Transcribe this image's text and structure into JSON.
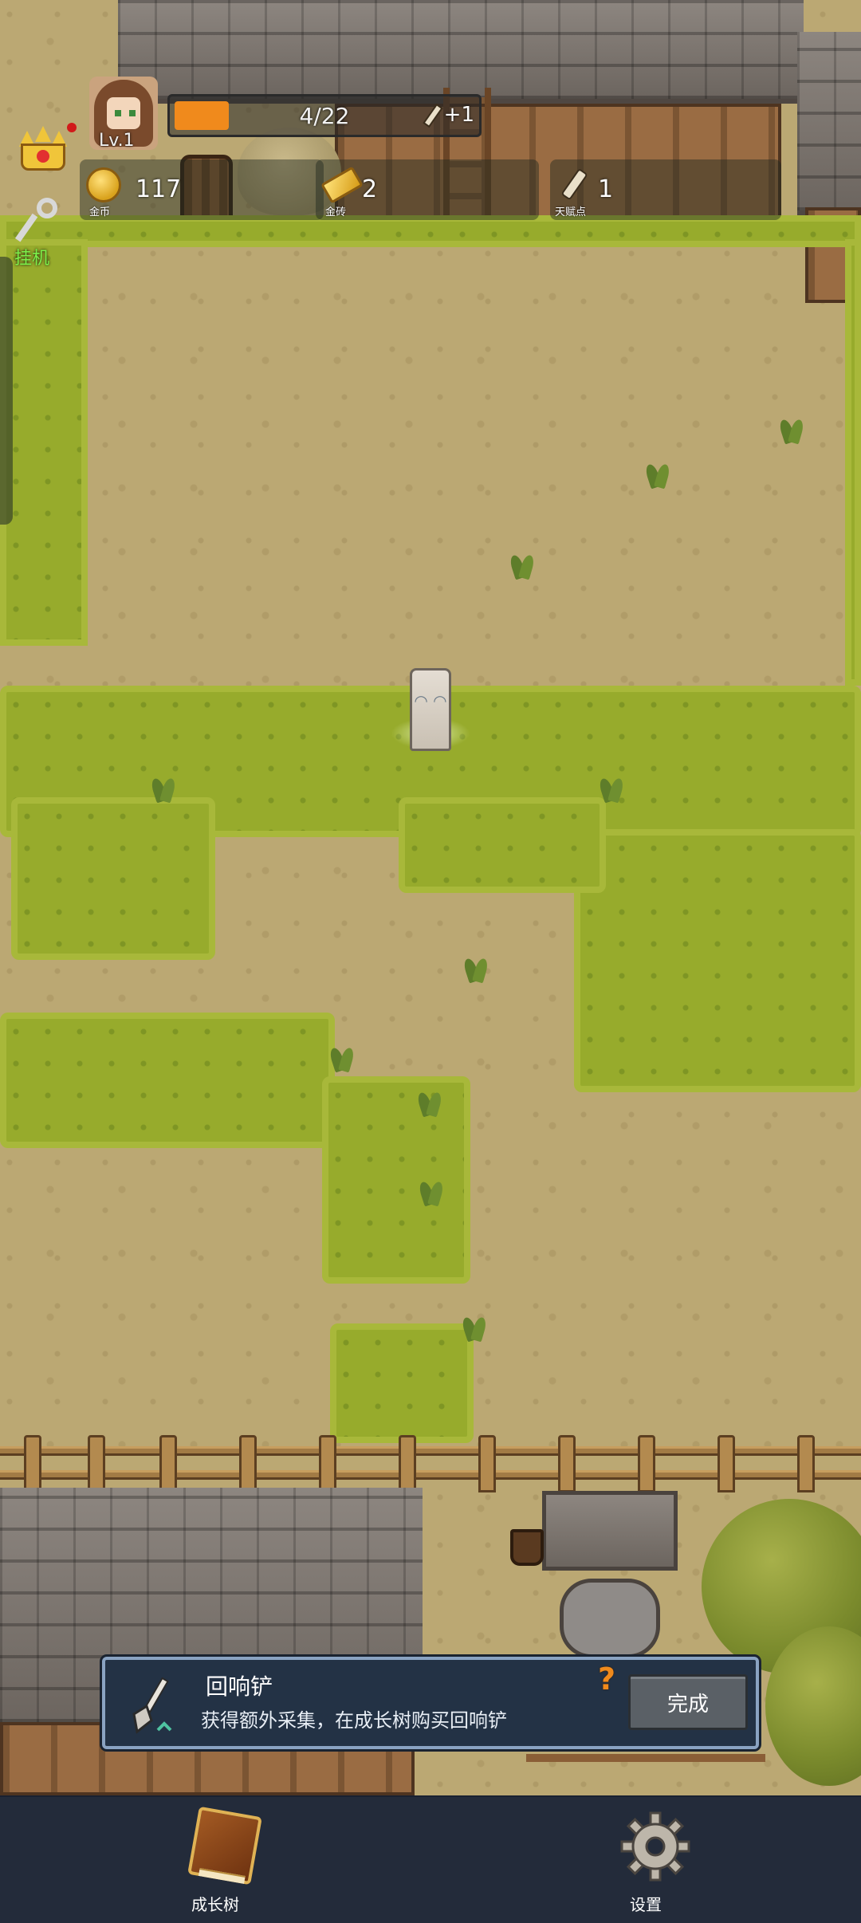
{
  "hud": {
    "level": "Lv.1",
    "xp_text": "4/22",
    "xp_fraction": 0.18,
    "xp_bonus": "+1",
    "idle_label": "挂机"
  },
  "resources": [
    {
      "name": "coin",
      "value": "117",
      "caption": "金币",
      "icon": "coin-icon"
    },
    {
      "name": "gold-brick",
      "value": "2",
      "caption": "金砖",
      "icon": "gold-brick-icon"
    },
    {
      "name": "talent",
      "value": "1",
      "caption": "天赋点",
      "icon": "talent-scroll-icon"
    }
  ],
  "quest": {
    "title": "回响铲",
    "description": "获得额外采集，在成长树购买回响铲",
    "help": "?",
    "complete_label": "完成",
    "icon": "shovel-icon"
  },
  "nav": {
    "growth_tree": "成长树",
    "settings": "设置"
  },
  "colors": {
    "xp_fill": "#f08a1c",
    "quest_bg": "#233245",
    "nav_bg": "#232b3a",
    "idle_text": "#7cf04a"
  }
}
